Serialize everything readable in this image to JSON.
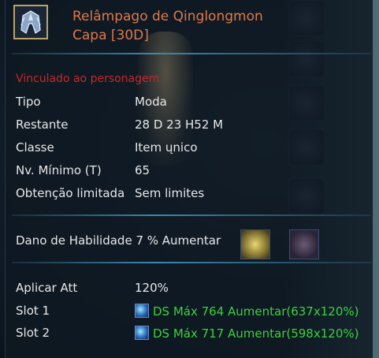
{
  "item": {
    "title_line1": "Relâmpago de Qinglongmon",
    "title_line2": "Capa [30D]",
    "bound": "Vinculado ao personagem"
  },
  "stats": [
    {
      "label": "Tipo",
      "value": "Moda"
    },
    {
      "label": "Restante",
      "value": "28 D 23 H52 M"
    },
    {
      "label": "Classe",
      "value": "Item ųnico"
    },
    {
      "label": "Nv. Mínimo (T)",
      "value": "65"
    },
    {
      "label": "Obtenção limitada",
      "value": "Sem limites"
    }
  ],
  "effect": "Dano de Habilidade 7 % Aumentar",
  "apply": {
    "label": "Aplicar Att",
    "value": "120%"
  },
  "slots": [
    {
      "label": "Slot 1",
      "value": "DS Máx 764 Aumentar(637x120%)"
    },
    {
      "label": "Slot 2",
      "value": "DS Máx 717 Aumentar(598x120%)"
    }
  ],
  "colors": {
    "title": "#e0784a",
    "bound": "#c22a2a",
    "slot_text": "#3cd23c"
  },
  "icons": {
    "item": "cape-icon",
    "slot": "digi-gem-icon"
  }
}
